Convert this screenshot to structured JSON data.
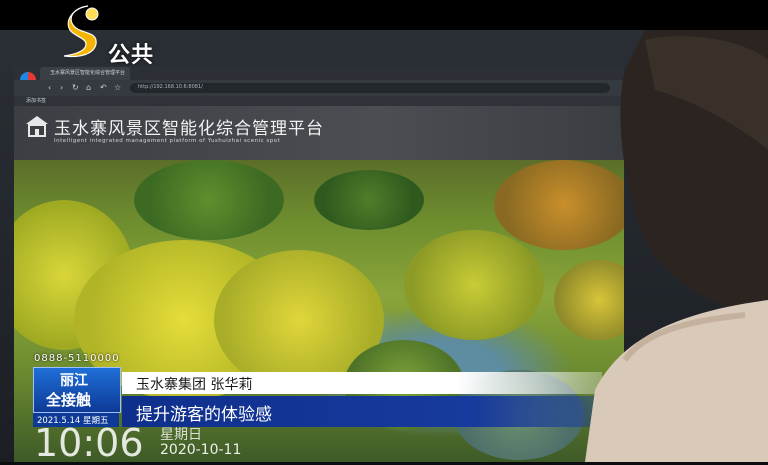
{
  "broadcast": {
    "channel_name": "公共"
  },
  "browser": {
    "tab_title": "玉水寨风景区智能化综合管理平台",
    "url": "http://192.168.10.6:8081/",
    "bookmark": "添加书签"
  },
  "platform": {
    "title": "玉水寨风景区智能化综合管理平台",
    "subtitle": "Intelligent integrated management platform of Yushuizhai scenic spot"
  },
  "overlay": {
    "hotline": "0888-5110000",
    "program_name_line1": "丽江",
    "program_name_line2": "全接触",
    "program_date": "2021.5.14 星期五",
    "speaker": "玉水寨集团  张华莉",
    "caption": "提升游客的体验感",
    "screen_clock_time": "10:06",
    "screen_clock_weekday": "星期日",
    "screen_clock_date": "2020-10-11"
  },
  "colors": {
    "caption_blue": "#173a9e",
    "logo_yellow": "#f5b400"
  }
}
